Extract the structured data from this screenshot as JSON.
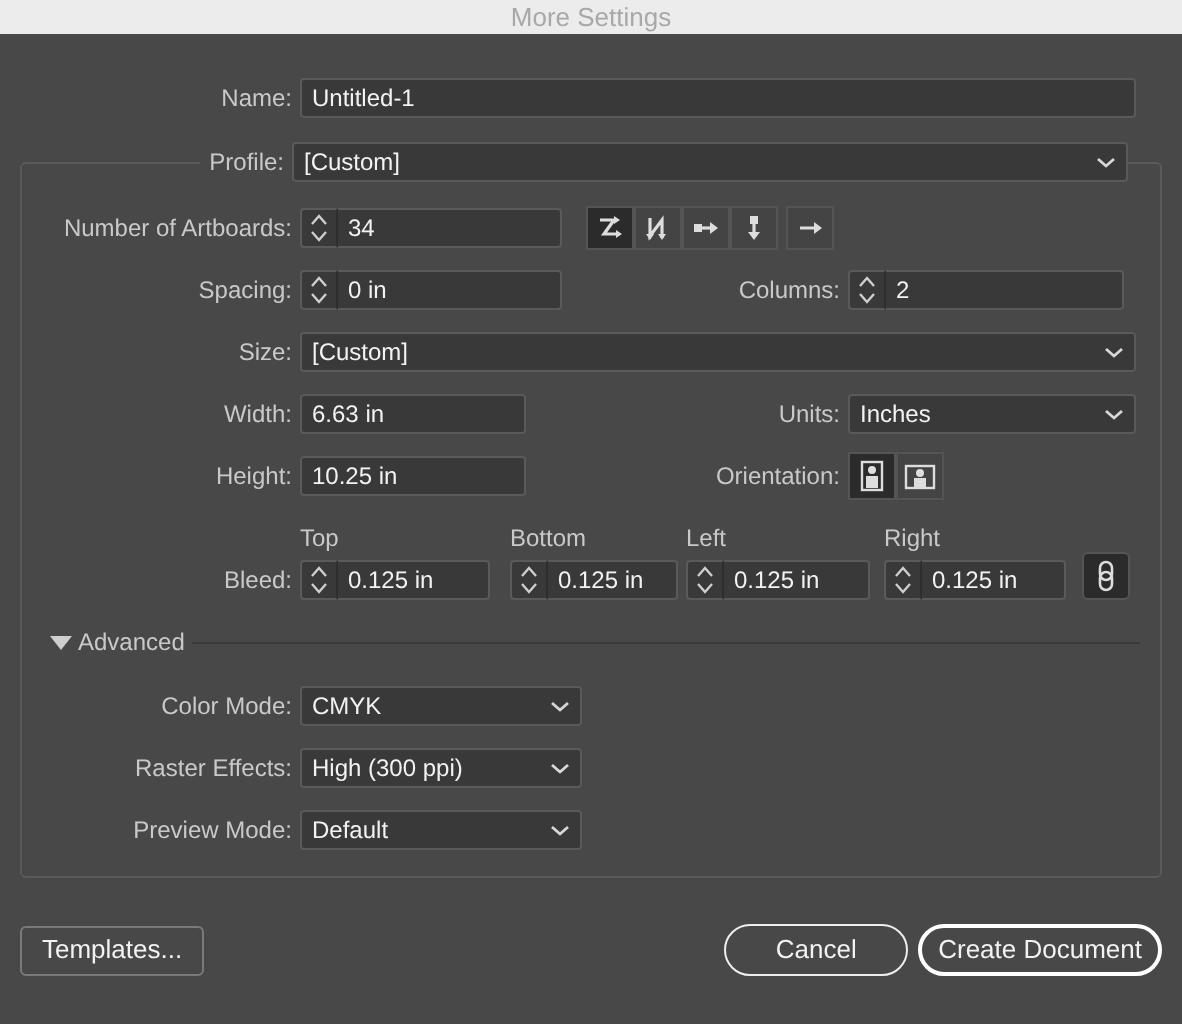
{
  "window": {
    "title": "More Settings"
  },
  "name": {
    "label": "Name:",
    "value": "Untitled-1"
  },
  "profile": {
    "label": "Profile:",
    "value": "[Custom]"
  },
  "artboards": {
    "label": "Number of Artboards:",
    "value": "34",
    "layouts": [
      {
        "kind": "grid-by-row",
        "selected": true
      },
      {
        "kind": "grid-by-column",
        "selected": false
      },
      {
        "kind": "row",
        "selected": false
      },
      {
        "kind": "column",
        "selected": false
      }
    ]
  },
  "spacing": {
    "label": "Spacing:",
    "value": "0 in"
  },
  "columns": {
    "label": "Columns:",
    "value": "2"
  },
  "size": {
    "label": "Size:",
    "value": "[Custom]"
  },
  "width": {
    "label": "Width:",
    "value": "6.63 in"
  },
  "units": {
    "label": "Units:",
    "value": "Inches"
  },
  "height": {
    "label": "Height:",
    "value": "10.25 in"
  },
  "orientation": {
    "label": "Orientation:",
    "options": [
      {
        "kind": "portrait",
        "selected": true
      },
      {
        "kind": "landscape",
        "selected": false
      }
    ]
  },
  "bleed": {
    "label": "Bleed:",
    "sides": [
      {
        "heading": "Top",
        "value": "0.125 in"
      },
      {
        "heading": "Bottom",
        "value": "0.125 in"
      },
      {
        "heading": "Left",
        "value": "0.125 in"
      },
      {
        "heading": "Right",
        "value": "0.125 in"
      }
    ],
    "linked": true
  },
  "advanced": {
    "label": "Advanced",
    "expanded": true,
    "settings": [
      {
        "label": "Color Mode:",
        "value": "CMYK"
      },
      {
        "label": "Raster Effects:",
        "value": "High (300 ppi)"
      },
      {
        "label": "Preview Mode:",
        "value": "Default"
      }
    ]
  },
  "buttons": {
    "templates": "Templates...",
    "cancel": "Cancel",
    "create": "Create Document"
  }
}
